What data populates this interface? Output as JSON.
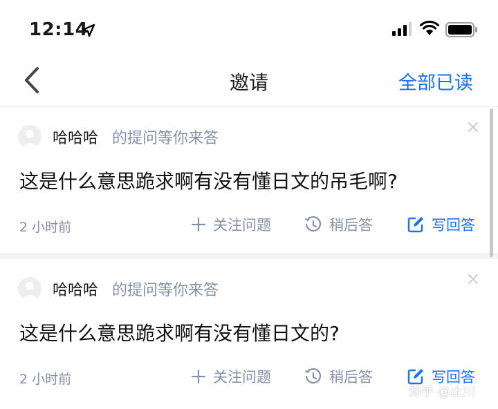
{
  "status_bar": {
    "time": "12:14"
  },
  "nav": {
    "title": "邀请",
    "read_all": "全部已读"
  },
  "invitations": [
    {
      "username": "哈哈哈",
      "meta": "的提问等你来答",
      "question": "这是什么意思跪求啊有没有懂日文的吊毛啊?",
      "time_ago": "2 小时前",
      "actions": {
        "follow": "关注问题",
        "later": "稍后答",
        "write": "写回答"
      }
    },
    {
      "username": "哈哈哈",
      "meta": "的提问等你来答",
      "question": "这是什么意思跪求啊有没有懂日文的?",
      "time_ago": "2 小时前",
      "actions": {
        "follow": "关注问题",
        "later": "稍后答",
        "write": "写回答"
      }
    }
  ],
  "watermark": "知乎 @止川",
  "colors": {
    "accent": "#1772f6",
    "muted": "#8590a6",
    "divider": "#f3f3f3"
  }
}
